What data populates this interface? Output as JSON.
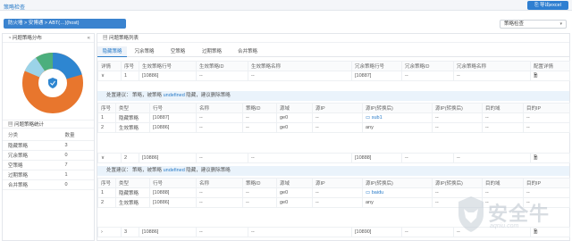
{
  "topbar": {
    "title": "策略检查",
    "export_label": "导出excel",
    "export_icon": "export-icon"
  },
  "breadcrumb": "防火墙 > 安博通 > ABT(…)(host)",
  "filter_select": {
    "value": "策略检查"
  },
  "left_panel": {
    "distribution_title": "问题策略分布",
    "stats_title": "问题策略统计",
    "stats_headers": [
      "分类",
      "数量"
    ],
    "stats_rows": [
      {
        "category": "隐藏策略",
        "count": "3"
      },
      {
        "category": "冗余策略",
        "count": "0"
      },
      {
        "category": "空策略",
        "count": "7"
      },
      {
        "category": "过期策略",
        "count": "1"
      },
      {
        "category": "合并策略",
        "count": "0"
      }
    ],
    "donut_colors": [
      "#e8762d",
      "#2e86d1",
      "#4caf7d",
      "#9bd3e8"
    ],
    "donut_center_icon": "shield-icon"
  },
  "right_panel": {
    "title": "问题策略列表",
    "tabs": [
      "隐藏策略",
      "冗余策略",
      "空策略",
      "过期策略",
      "合并策略"
    ],
    "main_headers": [
      "详情",
      "序号",
      "生效策略行号",
      "生效策略ID",
      "生效策略名称",
      "冗余策略行号",
      "冗余策略ID",
      "冗余策略名称",
      "配置详情"
    ],
    "groups": [
      {
        "seq": "1",
        "effective_line": "[10886]",
        "redundant_line": "[10887]"
      },
      {
        "seq": "2",
        "effective_line": "[10886]",
        "redundant_line": "[10888]"
      },
      {
        "seq": "3",
        "effective_line": "[10886]",
        "redundant_line": "[10890]"
      }
    ],
    "dash": "--",
    "advice_prefix": "处置建议：",
    "advice_mid": "策略，被策略",
    "advice_undefined": "undefined",
    "advice_suffix": "隐藏，建议删除策略",
    "sub_headers": [
      "序号",
      "类型",
      "行号",
      "名称",
      "策略ID",
      "源域",
      "源IP",
      "源IP(转换后)",
      "源IP(转换后)",
      "目的域",
      "目的IP"
    ],
    "sub_tables": [
      [
        {
          "seq": "1",
          "type": "隐藏策略",
          "line": "[10887]",
          "src_zone": "ge0",
          "src_ip_after": "sub1"
        },
        {
          "seq": "2",
          "type": "生效策略",
          "line": "[10886]",
          "src_zone": "ge0",
          "src_ip_after": "any"
        }
      ],
      [
        {
          "seq": "1",
          "type": "隐藏策略",
          "line": "[10888]",
          "src_zone": "ge0",
          "src_ip_after": "baidu"
        },
        {
          "seq": "2",
          "type": "生效策略",
          "line": "[10886]",
          "src_zone": "ge0",
          "src_ip_after": "any"
        }
      ]
    ]
  },
  "watermark": {
    "text": "安全牛",
    "sub": "aqniu.com"
  }
}
